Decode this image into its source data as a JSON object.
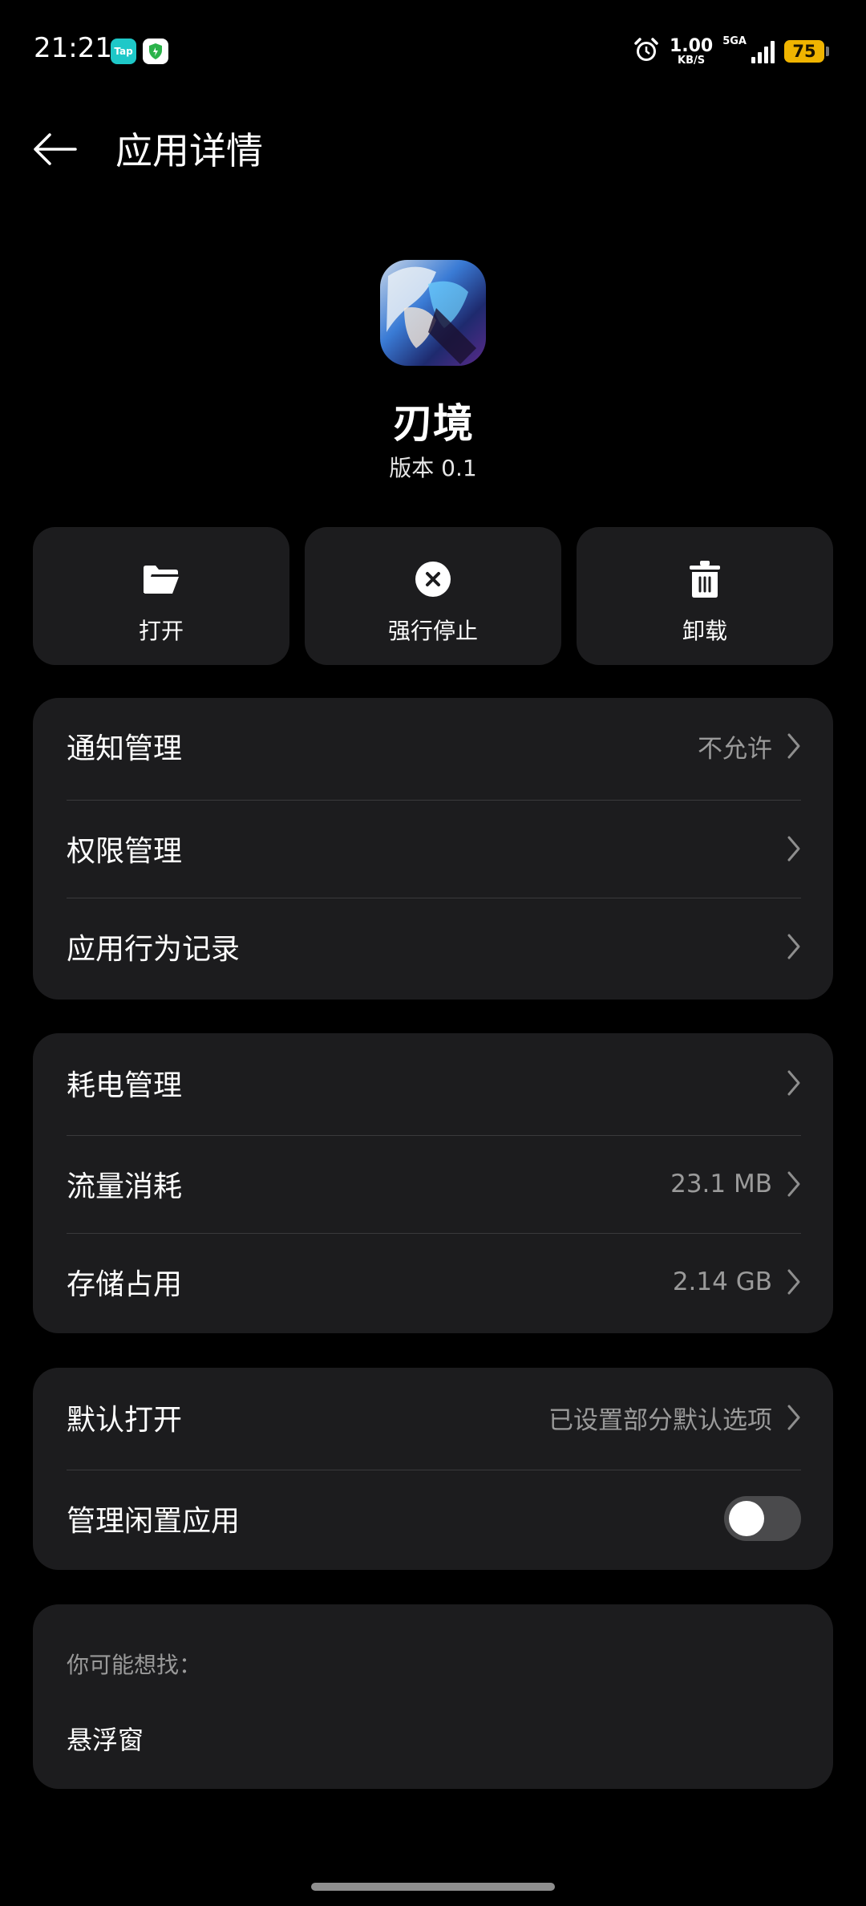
{
  "status_bar": {
    "time": "21:21",
    "tap_badge": "Tap",
    "net_speed_value": "1.00",
    "net_speed_unit": "KB/S",
    "network_type": "5GA",
    "battery": "75"
  },
  "header": {
    "title": "应用详情"
  },
  "app": {
    "name": "刃境",
    "version": "版本 0.1"
  },
  "actions": [
    {
      "label": "打开",
      "icon": "folder-icon"
    },
    {
      "label": "强行停止",
      "icon": "stop-icon"
    },
    {
      "label": "卸载",
      "icon": "trash-icon"
    }
  ],
  "card1": {
    "items": [
      {
        "label": "通知管理",
        "value": "不允许"
      },
      {
        "label": "权限管理",
        "value": ""
      },
      {
        "label": "应用行为记录",
        "value": ""
      }
    ]
  },
  "card2": {
    "items": [
      {
        "label": "耗电管理",
        "value": ""
      },
      {
        "label": "流量消耗",
        "value": "23.1 MB"
      },
      {
        "label": "存储占用",
        "value": "2.14 GB"
      }
    ]
  },
  "card3": {
    "items": [
      {
        "label": "默认打开",
        "value": "已设置部分默认选项"
      },
      {
        "label": "管理闲置应用",
        "toggle_on": false
      }
    ]
  },
  "suggest": {
    "hint": "你可能想找：",
    "items": [
      "悬浮窗"
    ]
  },
  "colors": {
    "background": "#000000",
    "card": "#1c1c1e",
    "battery": "#f0b400",
    "tap_badge": "#1ec8c8"
  }
}
